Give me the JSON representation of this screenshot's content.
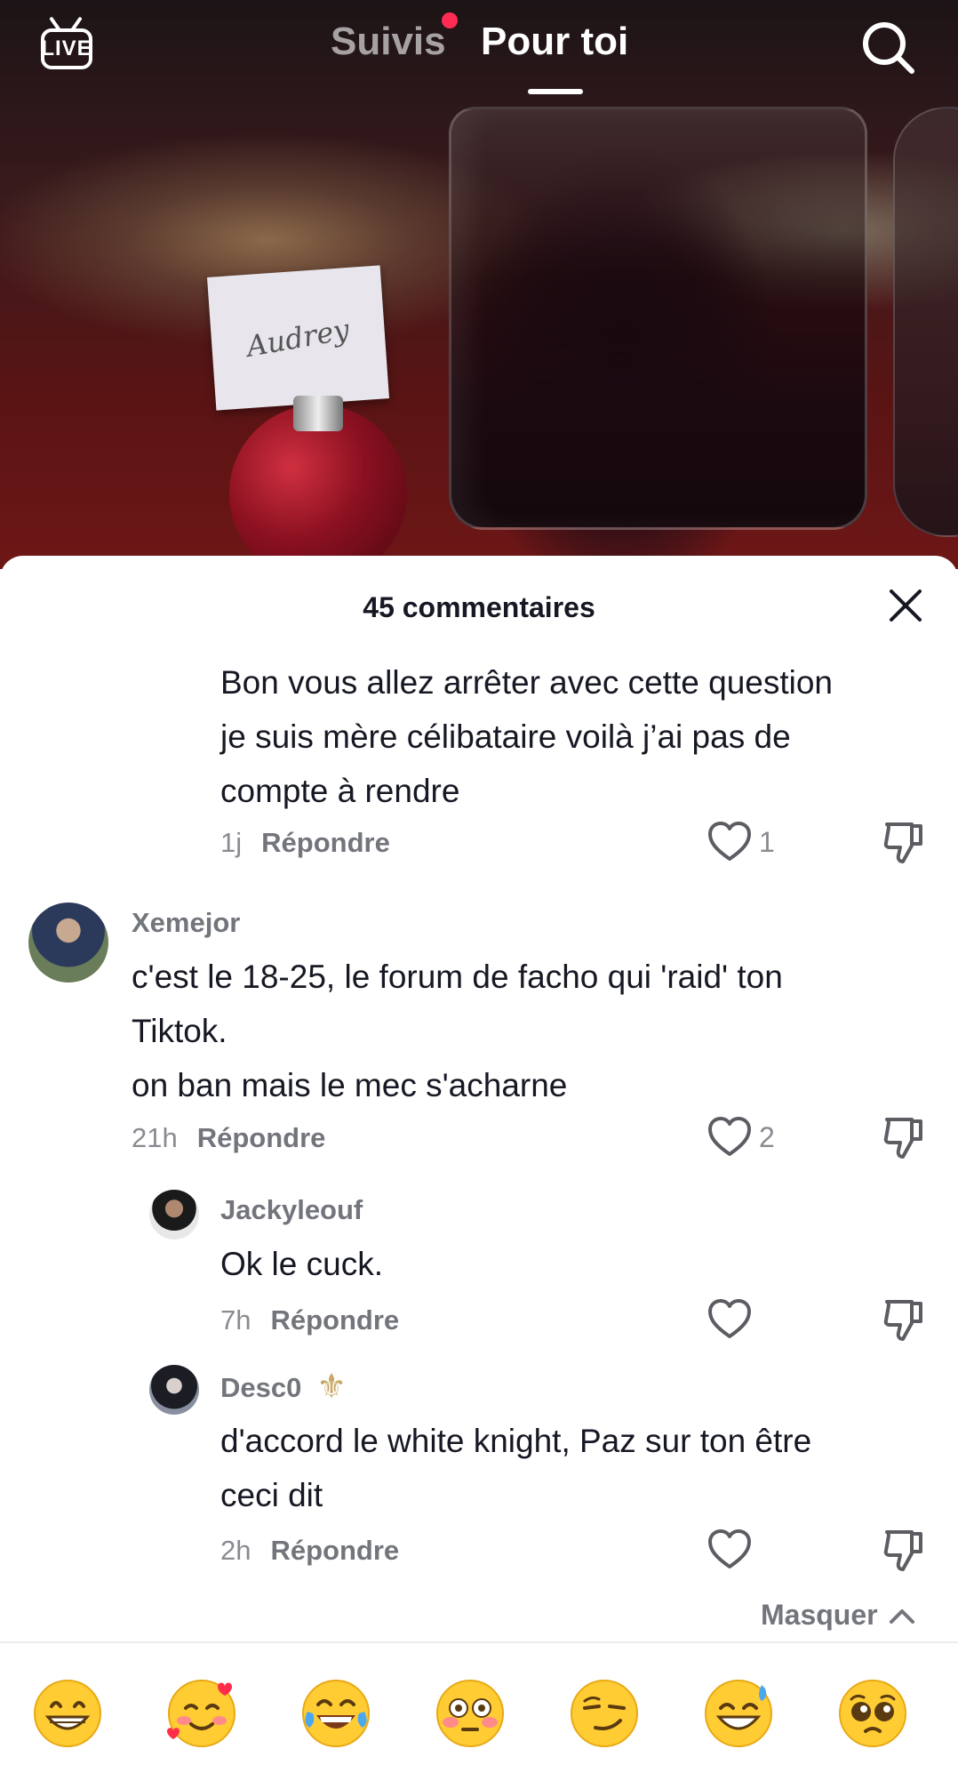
{
  "topbar": {
    "live_label": "LIVE",
    "tabs": [
      {
        "label": "Suivis",
        "active": false,
        "notification_dot": true
      },
      {
        "label": "Pour toi",
        "active": true
      }
    ]
  },
  "video": {
    "place_card_text": "Audrey"
  },
  "comments_sheet": {
    "title": "45 commentaires",
    "comments": [
      {
        "is_reply": true,
        "text_lines": [
          "Bon vous allez arrêter avec cette question",
          "je suis mère célibataire voilà j’ai pas de",
          "compte à rendre"
        ],
        "time": "1j",
        "reply_label": "Répondre",
        "likes": "1"
      },
      {
        "is_reply": false,
        "username": "Xemejor",
        "text_lines": [
          "c'est le 18-25, le forum de facho qui 'raid' ton",
          "Tiktok.",
          "on ban mais le mec s'acharne"
        ],
        "time": "21h",
        "reply_label": "Répondre",
        "likes": "2"
      },
      {
        "is_reply": true,
        "username": "Jackyleouf",
        "text_lines": [
          "Ok le cuck."
        ],
        "time": "7h",
        "reply_label": "Répondre",
        "likes": ""
      },
      {
        "is_reply": true,
        "username": "Desc0",
        "username_badge": "⚜",
        "text_lines": [
          "d'accord le white knight, Paz sur ton être",
          "ceci dit"
        ],
        "time": "2h",
        "reply_label": "Répondre",
        "likes": ""
      }
    ],
    "hide_label": "Masquer",
    "emoji_bar": [
      "😁",
      "🥰",
      "😂",
      "😳",
      "😏",
      "😅",
      "🥺"
    ]
  },
  "colors": {
    "accent_red": "#fe2c55",
    "text_primary": "#161823",
    "text_secondary": "#8a8b91"
  }
}
